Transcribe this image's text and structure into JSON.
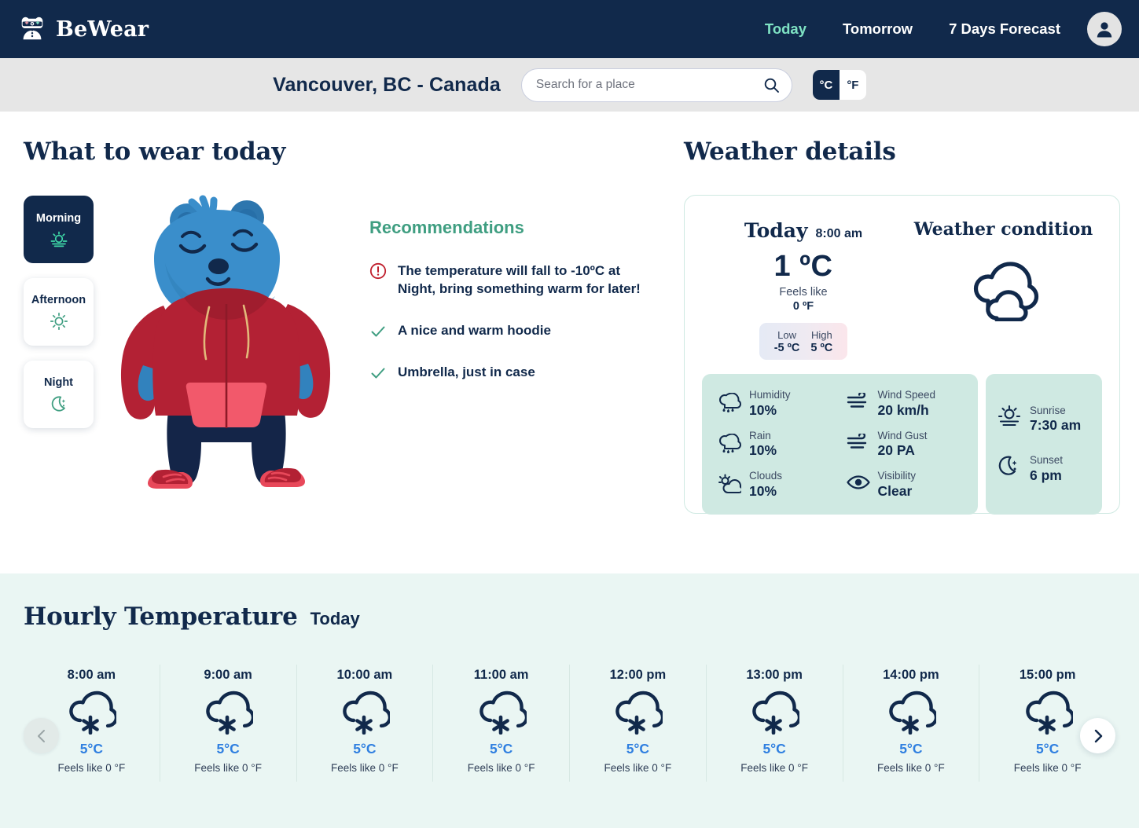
{
  "brand": {
    "name": "BeWear",
    "icon": "bear-logo-icon"
  },
  "nav": {
    "items": [
      {
        "label": "Today",
        "active": true
      },
      {
        "label": "Tomorrow",
        "active": false
      },
      {
        "label": "7 Days Forecast",
        "active": false
      }
    ],
    "avatar_icon": "user-avatar-icon"
  },
  "searchbar": {
    "city": "Vancouver, BC - Canada",
    "placeholder": "Search for a place",
    "value": "",
    "search_icon": "search-icon",
    "units": [
      {
        "label": "°C",
        "active": true
      },
      {
        "label": "°F",
        "active": false
      }
    ]
  },
  "wear": {
    "title": "What to wear today",
    "times_of_day": [
      {
        "label": "Morning",
        "icon": "sunrise-icon",
        "active": true
      },
      {
        "label": "Afternoon",
        "icon": "sun-icon",
        "active": false
      },
      {
        "label": "Night",
        "icon": "moon-stars-icon",
        "active": false
      }
    ],
    "mascot": "bear-in-red-hoodie-illustration",
    "recommendations": {
      "title": "Recommendations",
      "items": [
        {
          "icon": "alert-circle-icon",
          "text_a": "The temperature will fall to ",
          "highlight": "-10ºC",
          "text_b": " at Night, bring something warm for later!"
        },
        {
          "icon": "check-icon",
          "text": "A nice and warm hoodie"
        },
        {
          "icon": "check-icon",
          "text": "Umbrella, just in case"
        }
      ]
    }
  },
  "details": {
    "title": "Weather details",
    "today_label": "Today",
    "time": "8:00 am",
    "temperature": "1 ºC",
    "feels_like_label": "Feels like",
    "feels_like_value": "0 ºF",
    "low_label": "Low",
    "low_value": "-5 ºC",
    "high_label": "High",
    "high_value": "5 ºC",
    "condition_title": "Weather condition",
    "condition_icon": "clouds-icon",
    "metrics": [
      {
        "icon": "humidity-cloud-icon",
        "label": "Humidity",
        "value": "10%"
      },
      {
        "icon": "wind-icon",
        "label": "Wind Speed",
        "value": "20 km/h"
      },
      {
        "icon": "rain-cloud-icon",
        "label": "Rain",
        "value": "10%"
      },
      {
        "icon": "wind-icon",
        "label": "Wind Gust",
        "value": "20 PA"
      },
      {
        "icon": "partly-cloudy-icon",
        "label": "Clouds",
        "value": "10%"
      },
      {
        "icon": "eye-icon",
        "label": "Visibility",
        "value": "Clear"
      }
    ],
    "sun": [
      {
        "icon": "sunrise-icon",
        "label": "Sunrise",
        "value": "7:30 am"
      },
      {
        "icon": "moon-stars-icon",
        "label": "Sunset",
        "value": "6 pm"
      }
    ]
  },
  "hourly": {
    "title": "Hourly Temperature",
    "subtitle": "Today",
    "prev_icon": "chevron-left-icon",
    "next_icon": "chevron-right-icon",
    "entries": [
      {
        "time": "8:00 am",
        "icon": "snow-cloud-icon",
        "temp": "5°C",
        "feels": "Feels like 0 °F"
      },
      {
        "time": "9:00 am",
        "icon": "snow-cloud-icon",
        "temp": "5°C",
        "feels": "Feels like 0 °F"
      },
      {
        "time": "10:00 am",
        "icon": "snow-cloud-icon",
        "temp": "5°C",
        "feels": "Feels like 0 °F"
      },
      {
        "time": "11:00 am",
        "icon": "snow-cloud-icon",
        "temp": "5°C",
        "feels": "Feels like 0 °F"
      },
      {
        "time": "12:00 pm",
        "icon": "snow-cloud-icon",
        "temp": "5°C",
        "feels": "Feels like 0 °F"
      },
      {
        "time": "13:00 pm",
        "icon": "snow-cloud-icon",
        "temp": "5°C",
        "feels": "Feels like 0 °F"
      },
      {
        "time": "14:00 pm",
        "icon": "snow-cloud-icon",
        "temp": "5°C",
        "feels": "Feels like 0 °F"
      },
      {
        "time": "15:00 pm",
        "icon": "snow-cloud-icon",
        "temp": "5°C",
        "feels": "Feels like 0 °F"
      }
    ]
  },
  "colors": {
    "navy": "#11294b",
    "mint_accent": "#7fe3c4",
    "green_text": "#3f9e81",
    "mint_panel": "#cfe9e2",
    "hourly_bg": "#eaf6f3",
    "hour_temp_blue": "#2f7fe0",
    "alert_red": "#c0202e"
  }
}
